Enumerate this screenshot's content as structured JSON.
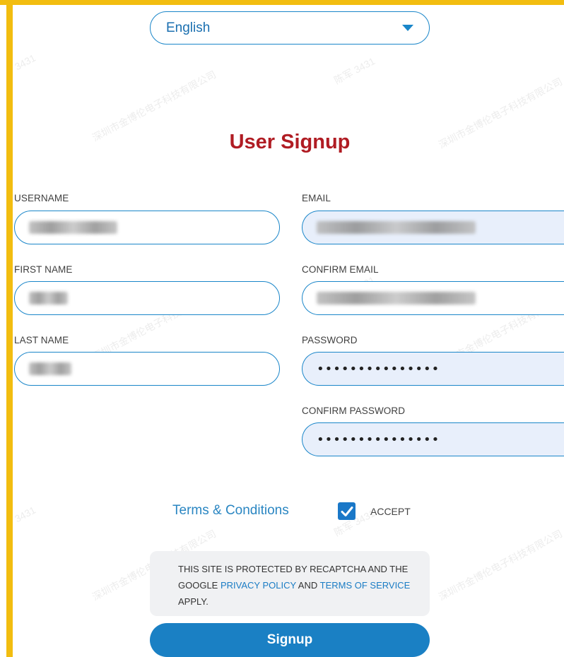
{
  "language_select": {
    "value": "English",
    "caret_icon": "caret-down-icon"
  },
  "title": "User Signup",
  "fields": {
    "username": {
      "label": "USERNAME"
    },
    "first_name": {
      "label": "FIRST NAME"
    },
    "last_name": {
      "label": "LAST NAME"
    },
    "email": {
      "label": "EMAIL"
    },
    "confirm_email": {
      "label": "CONFIRM EMAIL"
    },
    "password": {
      "label": "PASSWORD",
      "value": "•••••••••••••••"
    },
    "confirm_password": {
      "label": "CONFIRM PASSWORD",
      "value": "•••••••••••••••"
    }
  },
  "terms": {
    "link": "Terms & Conditions",
    "accept_label": "ACCEPT",
    "checked": true
  },
  "recaptcha": {
    "line1": "THIS SITE IS PROTECTED BY RECAPTCHA AND THE GOOGLE ",
    "privacy_link": "PRIVACY POLICY",
    "and": " AND ",
    "terms_link": "TERMS OF SERVICE",
    "apply": " APPLY."
  },
  "signup_button": "Signup",
  "watermark": {
    "company": "深圳市金博伦电子科技有限公司",
    "user": "陈军 3431",
    "code": "3431"
  },
  "colors": {
    "accent": "#1a80c4",
    "title": "#b01c23",
    "frame": "#f2bd10",
    "filled_bg": "#e8effb"
  }
}
